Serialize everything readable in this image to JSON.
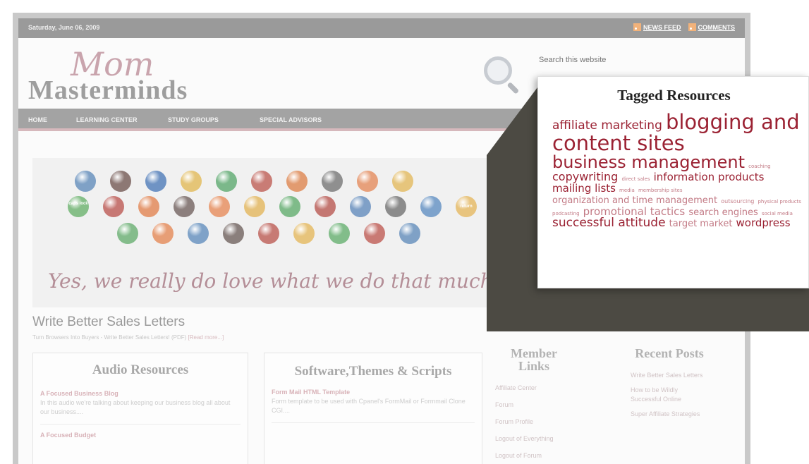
{
  "site": {
    "date": "Saturday, June 06, 2009",
    "feeds": [
      {
        "label": "NEWS FEED"
      },
      {
        "label": "COMMENTS"
      }
    ],
    "logo": {
      "line1": "Mom",
      "line2": "Masterminds"
    },
    "search": {
      "placeholder": "Search this website"
    },
    "nav": [
      {
        "label": "HOME"
      },
      {
        "label": "LEARNING CENTER"
      },
      {
        "label": "STUDY GROUPS"
      },
      {
        "label": "SPECIAL ADVISORS"
      }
    ],
    "banner": {
      "tagline": "Yes, we really do love what we do that much...",
      "ball_labels": [
        "caps lock",
        "return"
      ],
      "ball_colors": [
        "#7fa1c6",
        "#8d7874",
        "#6f93c4",
        "#e5c577",
        "#7bb88a",
        "#c97c75",
        "#e29b70",
        "#8f8f8f",
        "#e7a07b",
        "#e6c57c",
        "#86bf88",
        "#c77874",
        "#e59a72",
        "#8c7f7d",
        "#e9a079",
        "#e6c27a",
        "#7fbb89",
        "#c47772",
        "#7fa0c7",
        "#8c8c8c",
        "#7ea3cc",
        "#e8c47e",
        "#84bc8b",
        "#e79e76",
        "#7fa2c8",
        "#8a7f7c",
        "#c77a74",
        "#e7c47c",
        "#82bd8a",
        "#c97a74"
      ]
    },
    "post": {
      "title": "Write Better Sales Letters",
      "subtitle": "Turn Browsers Into Buyers - Write Better Sales Letters! (PDF)",
      "read_more": "[Read more...]"
    },
    "audio": {
      "title": "Audio Resources",
      "items": [
        {
          "title": "A Focused Business Blog",
          "text": "In this audio we're talking about keeping our business blog all about our business...."
        },
        {
          "title": "A Focused Budget",
          "text": ""
        }
      ]
    },
    "software": {
      "title": "Software,Themes & Scripts",
      "items": [
        {
          "title": "Form Mail HTML Template",
          "text": "Form template to be used with Cpanel's FormMail or Formmail Clone CGI...."
        }
      ]
    },
    "member_links": {
      "title": "Member Links",
      "items": [
        "Affiliate Center",
        "Forum",
        "Forum Profile",
        "Logout of Everything",
        "Logout of Forum"
      ]
    },
    "recent_posts": {
      "title": "Recent Posts",
      "items": [
        "Write Better Sales Letters",
        "How to be Wildly Successful Online",
        "Super Affiliate Strategies"
      ]
    }
  },
  "callout": {
    "title": "Tagged Resources",
    "tags": [
      {
        "text": "affiliate marketing",
        "size": 17
      },
      {
        "text": "blogging and content sites",
        "size": 29
      },
      {
        "text": "business management",
        "size": 24
      },
      {
        "text": "coaching",
        "size": 7,
        "dim": true
      },
      {
        "text": "copywriting",
        "size": 16
      },
      {
        "text": "direct sales",
        "size": 7,
        "dim": true
      },
      {
        "text": "information products",
        "size": 15
      },
      {
        "text": "mailing lists",
        "size": 15
      },
      {
        "text": "media",
        "size": 7,
        "dim": true
      },
      {
        "text": "membership sites",
        "size": 7,
        "dim": true
      },
      {
        "text": "organization and time management",
        "size": 13,
        "dim": true
      },
      {
        "text": "outsourcing",
        "size": 8,
        "dim": true
      },
      {
        "text": "physical products",
        "size": 7,
        "dim": true
      },
      {
        "text": "podcasting",
        "size": 7,
        "dim": true
      },
      {
        "text": "promotional tactics",
        "size": 15,
        "dim": true
      },
      {
        "text": "search engines",
        "size": 13,
        "dim": true
      },
      {
        "text": "social media",
        "size": 7,
        "dim": true
      },
      {
        "text": "successful attitude",
        "size": 17
      },
      {
        "text": "target market",
        "size": 13,
        "dim": true
      },
      {
        "text": "wordpress",
        "size": 15
      }
    ]
  }
}
